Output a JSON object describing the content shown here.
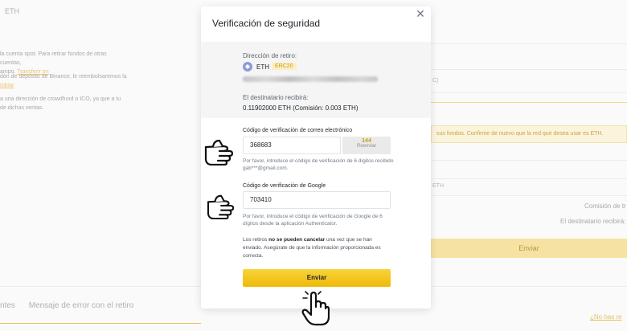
{
  "background": {
    "top_label": "ETH",
    "left_paragraphs": [
      {
        "text": "la cuenta spot. Para retirar fondos de otras cuentas,",
        "text2": "ampo. ",
        "link": "Transferir en"
      },
      {
        "text": "dón de depósito de Binance, le reembolsaremos la",
        "link2": "mbiar"
      },
      {
        "text": "a una dirección de crowdfund o ICO, ya que a tu",
        "text2": "de dichas ventas."
      }
    ],
    "warning": "sus fondos. Confirme de nuevo que la red que desea usar es ETH.",
    "eth_small": "ETH",
    "comision_label": "Comisión de tr",
    "destinatario_label": "El destinatario recibirá:",
    "submit_label": "Enviar",
    "tabs": [
      "ntes",
      "Mensaje de error con el retiro"
    ],
    "no_has": "¿No has re"
  },
  "modal": {
    "title": "Verificación de seguridad",
    "address_label": "Dirección de retiro:",
    "coin": "ETH",
    "network": "ERC20",
    "receive_label": "El destinatario recibirá:",
    "receive_amount": "0.11902000 ETH (Comisión: 0.003 ETH)",
    "email": {
      "label": "Código de verificación de correo electrónico",
      "value": "368683",
      "resend_count": "144",
      "resend_label": "Reenviar",
      "help": "Por favor, introduce el código de verificación de 6 dígitos recibido gab***@gmail.com."
    },
    "google": {
      "label": "Código de verificación de Google",
      "value": "703410",
      "help": "Por favor, introduce el código de verificación de Google de 6 dígitos desde la aplicación Authenticator."
    },
    "notice_pre": "Los retiros ",
    "notice_bold": "no se pueden cancelar",
    "notice_post": " una vez que se han enviado. Asegúrate de que la información proporcionada es correcta.",
    "submit_label": "Enviar"
  },
  "icons": [
    "close-icon",
    "eth-icon",
    "pointing-hand-icon",
    "click-hand-icon"
  ],
  "colors": {
    "accent": "#f0b90b",
    "badge_bg": "#fcefc3",
    "badge_text": "#c99a15"
  }
}
